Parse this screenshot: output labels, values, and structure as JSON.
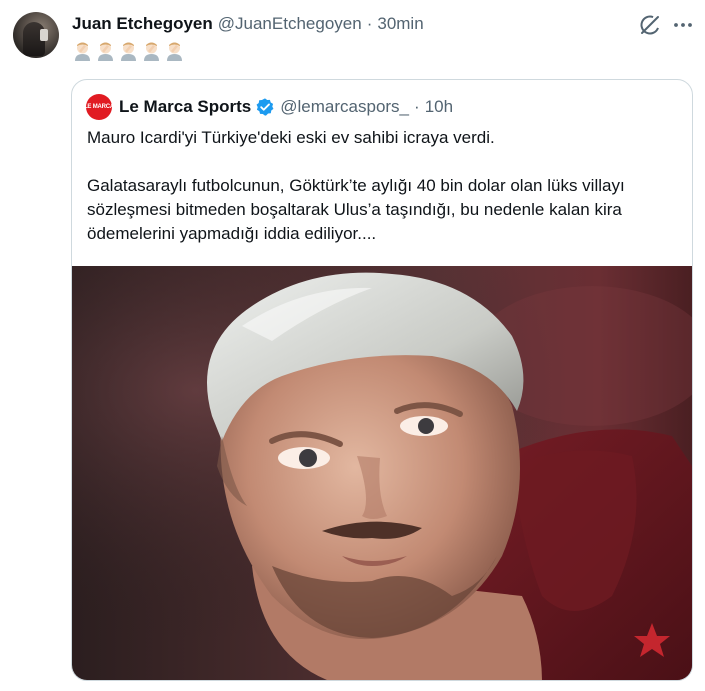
{
  "tweet": {
    "display_name": "Juan Etchegoyen",
    "handle": "@JuanEtchegoyen",
    "separator": "·",
    "time": "30min",
    "emoji": [
      "🤦🏻‍♂️",
      "🤦🏻‍♂️",
      "🤦🏻‍♂️",
      "🤦🏻‍♂️",
      "🤦🏻‍♂️"
    ],
    "icons": {
      "grok": "grok-icon",
      "more": "more-icon"
    }
  },
  "quoted": {
    "avatar_text": "LE MARCA",
    "display_name": "Le Marca Sports",
    "verified_icon": "verified-badge-icon",
    "handle": "@lemarcaspors_",
    "separator": "·",
    "time": "10h",
    "text": "Mauro Icardi'yi Türkiye'deki eski ev sahibi icraya verdi.\n\nGalatasaraylı futbolcunun, Göktürk’te aylığı 40 bin dolar olan lüks villayı sözleşmesi bitmeden boşaltarak Ulus’a taşındığı, bu nedenle kalan kira ödemelerini yapmadığı iddia ediliyor....",
    "media": "photo"
  },
  "colors": {
    "text_primary": "#0f1419",
    "text_secondary": "#536471",
    "border": "#cfd9de",
    "verified": "#1d9bf0",
    "brand_red": "#e11b22"
  }
}
